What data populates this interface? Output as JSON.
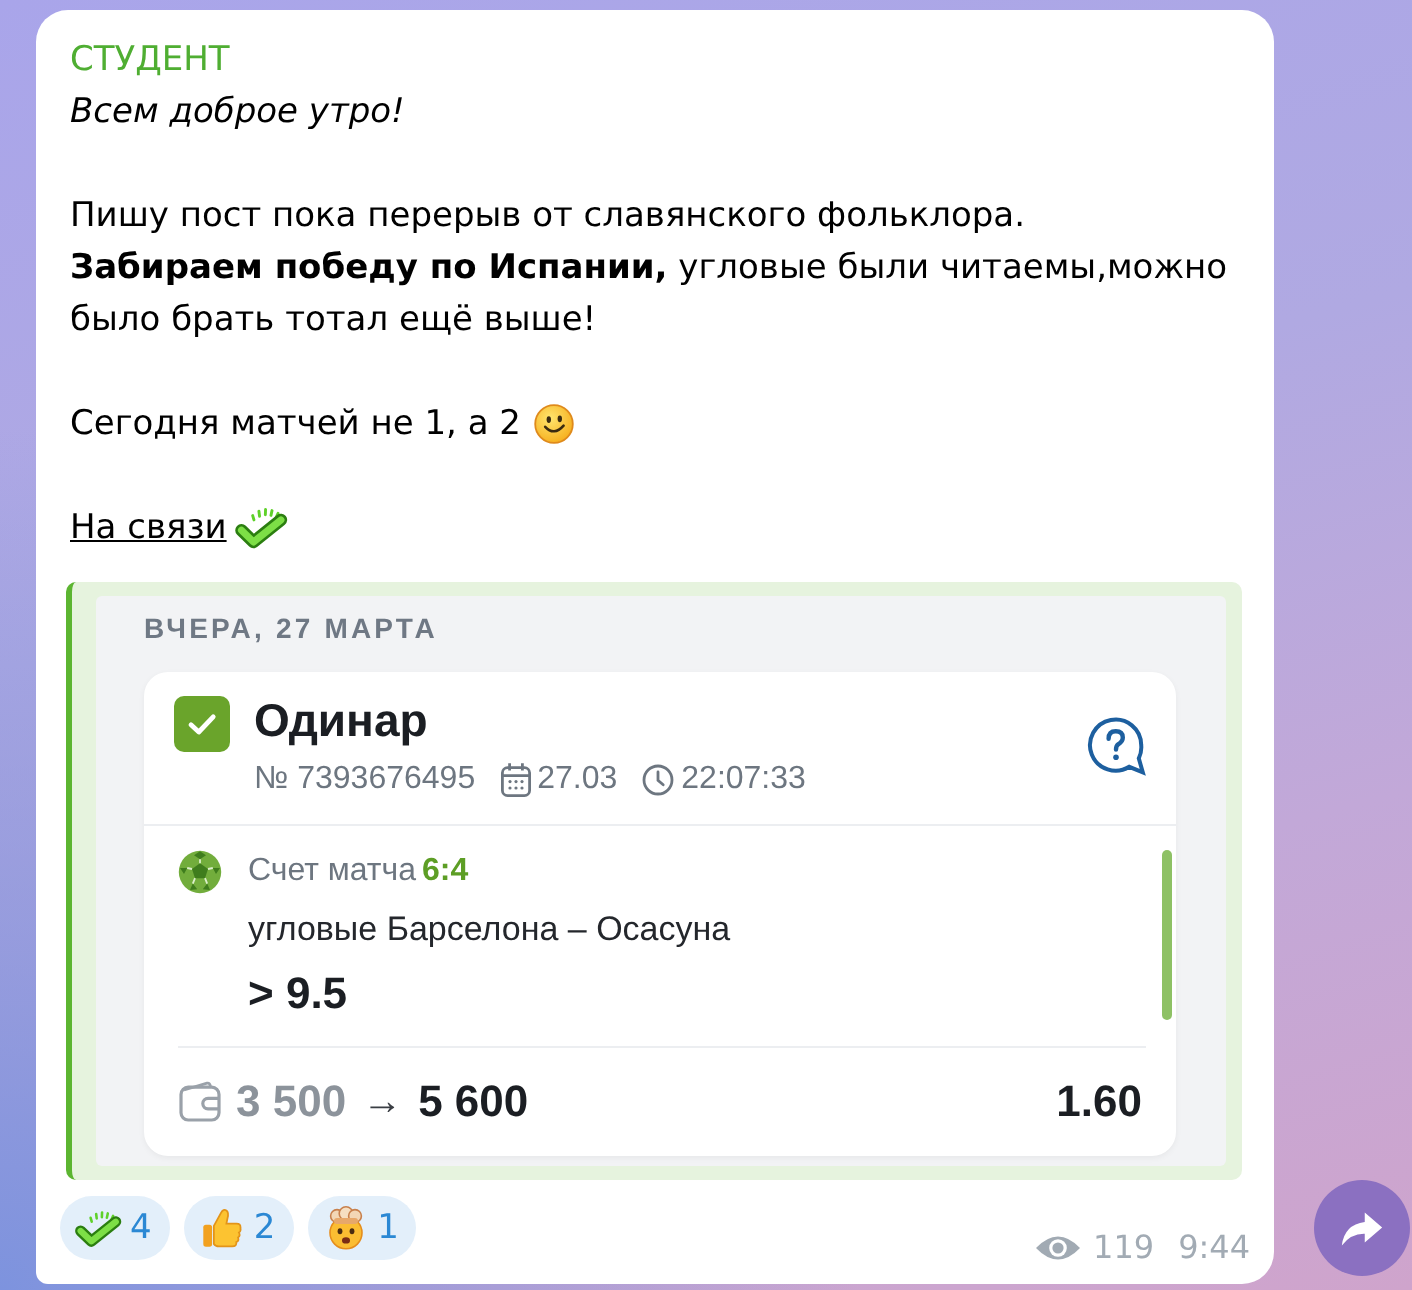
{
  "message": {
    "sender": "СТУДЕНТ",
    "blocks": [
      {
        "kind": "italic",
        "text": "Всем доброе утро!"
      },
      {
        "kind": "text",
        "text": "Пишу пост пока перерыв от славянского фольклора.\n**Забираем победу по Испании,** угловые были читаемы,можно было брать тотал ещё выше!"
      },
      {
        "kind": "text",
        "text": "Сегодня матчей не 1, а 2"
      },
      {
        "kind": "link",
        "text": "На связи"
      }
    ],
    "bet_slip": {
      "date_header": "ВЧЕРА, 27 МАРТА",
      "checked": true,
      "title": "Одинар",
      "number": "№ 7393676495",
      "date": "27.03",
      "time": "22:07:33",
      "score_label": "Счет матча",
      "score": "6:4",
      "market": "угловые Барселона – Осасуна",
      "outcome": "> 9.5",
      "stake": "3 500",
      "arrow": "→",
      "payout": "5 600",
      "odds": "1.60"
    },
    "reactions": [
      {
        "count": "4",
        "selected": false
      },
      {
        "count": "2",
        "selected": false
      },
      {
        "count": "1",
        "selected": false
      }
    ],
    "views": "119",
    "time": "9:44"
  }
}
